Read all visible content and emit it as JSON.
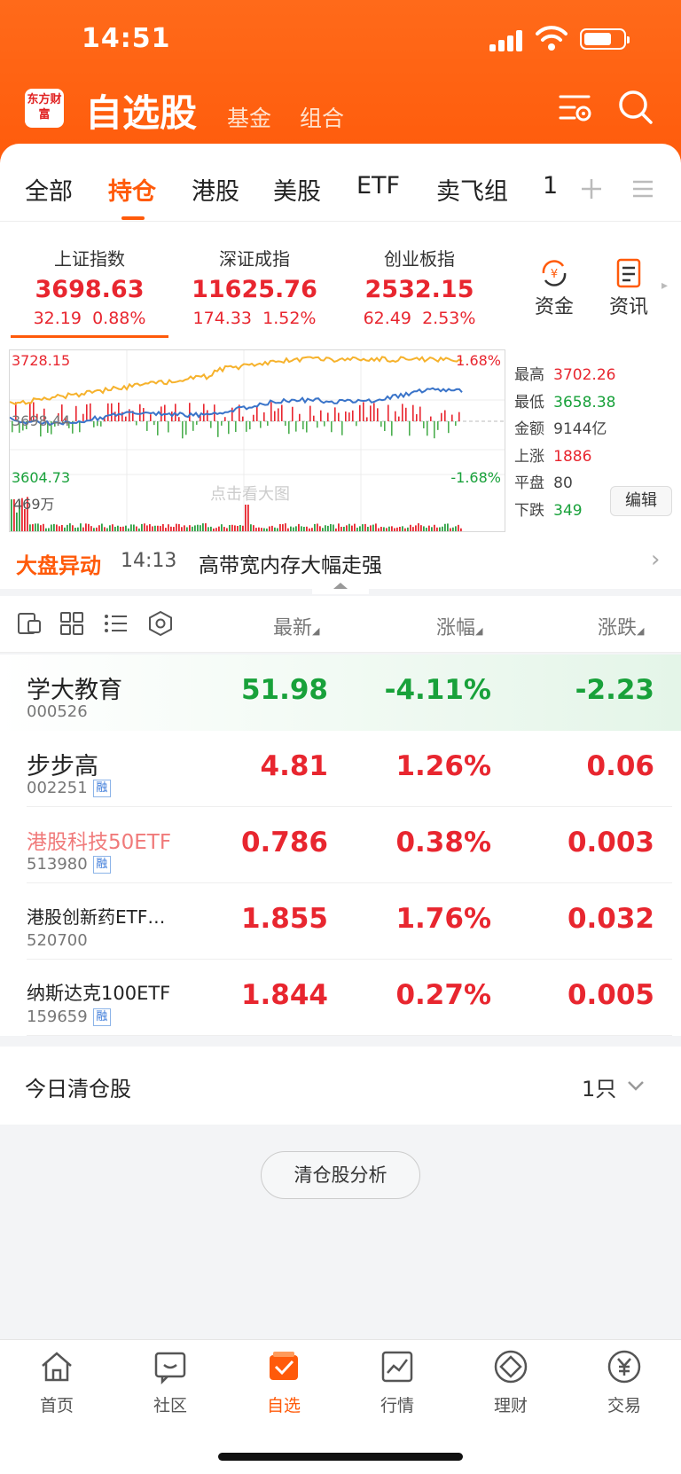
{
  "status_bar": {
    "time": "14:51"
  },
  "header": {
    "logo_text": "东方财富",
    "title": "自选股",
    "subtabs": [
      "基金",
      "组合"
    ]
  },
  "category_tabs": {
    "items": [
      "全部",
      "持仓",
      "港股",
      "美股",
      "ETF",
      "卖飞组",
      "1"
    ],
    "active": "持仓"
  },
  "indices": [
    {
      "name": "上证指数",
      "value": "3698.63",
      "change": "32.19",
      "pct": "0.88%"
    },
    {
      "name": "深证成指",
      "value": "11625.76",
      "change": "174.33",
      "pct": "1.52%"
    },
    {
      "name": "创业板指",
      "value": "2532.15",
      "change": "62.49",
      "pct": "2.53%"
    }
  ],
  "quick_buttons": {
    "funds": "资金",
    "news": "资讯"
  },
  "chart": {
    "top_price": "3728.15",
    "mid_price": "3698.44",
    "bottom_price": "3604.73",
    "top_pct": "1.68%",
    "bottom_pct": "-1.68%",
    "volume": "469万",
    "watermark": "点击看大图"
  },
  "market_stats": [
    {
      "label": "最高",
      "value": "3702.26",
      "color": "#e8262f"
    },
    {
      "label": "最低",
      "value": "3658.38",
      "color": "#18a13a"
    },
    {
      "label": "金额",
      "value": "9144亿",
      "color": "#444444"
    },
    {
      "label": "上涨",
      "value": "1886",
      "color": "#e8262f"
    },
    {
      "label": "平盘",
      "value": "80",
      "color": "#444444"
    },
    {
      "label": "下跌",
      "value": "349",
      "color": "#18a13a"
    }
  ],
  "edit_label": "编辑",
  "news": {
    "tag": "大盘异动",
    "time": "14:13",
    "headline": "高带宽内存大幅走强"
  },
  "list_header": {
    "latest": "最新",
    "pct": "涨幅",
    "change": "涨跌"
  },
  "stocks": [
    {
      "name": "学大教育",
      "code": "000526",
      "rong": false,
      "price": "51.98",
      "pct": "-4.11%",
      "change": "-2.23",
      "trend": "down"
    },
    {
      "name": "步步高",
      "code": "002251",
      "rong": true,
      "price": "4.81",
      "pct": "1.26%",
      "change": "0.06",
      "trend": "up"
    },
    {
      "name": "港股科技50ETF",
      "code": "513980",
      "rong": true,
      "price": "0.786",
      "pct": "0.38%",
      "change": "0.003",
      "trend": "up"
    },
    {
      "name": "港股创新药ETF…",
      "code": "520700",
      "rong": false,
      "price": "1.855",
      "pct": "1.76%",
      "change": "0.032",
      "trend": "up"
    },
    {
      "name": "纳斯达克100ETF",
      "code": "159659",
      "rong": true,
      "price": "1.844",
      "pct": "0.27%",
      "change": "0.005",
      "trend": "up"
    }
  ],
  "rong_label": "融",
  "clearance": {
    "label": "今日清仓股",
    "count": "1只",
    "button": "清仓股分析"
  },
  "bottom_nav": [
    "首页",
    "社区",
    "自选",
    "行情",
    "理财",
    "交易"
  ],
  "bottom_nav_active": "自选",
  "colors": {
    "brand": "#ff5a0a",
    "up": "#e8262f",
    "down": "#18a13a"
  }
}
